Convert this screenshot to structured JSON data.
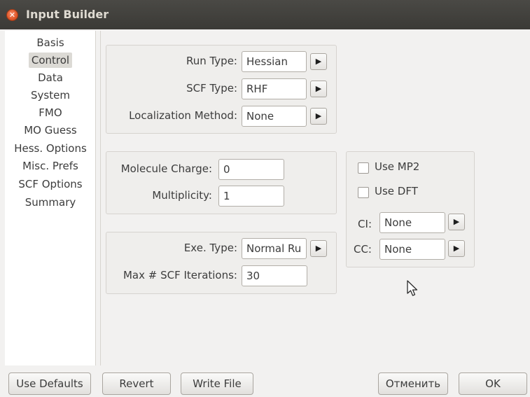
{
  "window": {
    "title": "Input Builder",
    "close_icon": "close-icon"
  },
  "sidebar": {
    "items": [
      {
        "label": "Basis",
        "selected": false
      },
      {
        "label": "Control",
        "selected": true
      },
      {
        "label": "Data",
        "selected": false
      },
      {
        "label": "System",
        "selected": false
      },
      {
        "label": "FMO",
        "selected": false
      },
      {
        "label": "MO Guess",
        "selected": false
      },
      {
        "label": "Hess. Options",
        "selected": false
      },
      {
        "label": "Misc. Prefs",
        "selected": false
      },
      {
        "label": "SCF Options",
        "selected": false
      },
      {
        "label": "Summary",
        "selected": false
      }
    ]
  },
  "run_group": {
    "run_type_label": "Run Type:",
    "run_type_value": "Hessian",
    "scf_type_label": "SCF Type:",
    "scf_type_value": "RHF",
    "localization_label": "Localization Method:",
    "localization_value": "None"
  },
  "charge_group": {
    "charge_label": "Molecule Charge:",
    "charge_value": "0",
    "multiplicity_label": "Multiplicity:",
    "multiplicity_value": "1"
  },
  "exe_group": {
    "exe_type_label": "Exe. Type:",
    "exe_type_value": "Normal Ru",
    "max_scf_label": "Max # SCF Iterations:",
    "max_scf_value": "30"
  },
  "method_group": {
    "use_mp2_label": "Use MP2",
    "use_mp2_checked": false,
    "use_dft_label": "Use DFT",
    "use_dft_checked": false,
    "ci_label": "CI:",
    "ci_value": "None",
    "cc_label": "CC:",
    "cc_value": "None"
  },
  "buttons": {
    "use_defaults": "Use Defaults",
    "revert": "Revert",
    "write_file": "Write File",
    "cancel": "Отменить",
    "ok": "OK"
  },
  "icons": {
    "dropdown_arrow": "play-arrow-icon",
    "cursor": "mouse-pointer-icon"
  },
  "colors": {
    "titlebar": "#3b3a36",
    "close_button": "#e0582a",
    "window_bg": "#f2f1f0"
  }
}
